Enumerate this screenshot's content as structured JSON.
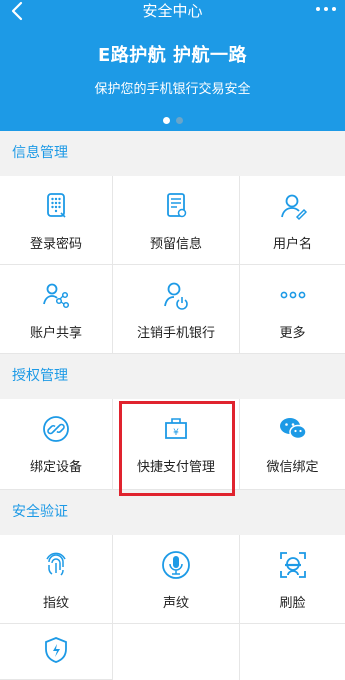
{
  "header": {
    "title": "安全中心"
  },
  "banner": {
    "title": "E路护航 护航一路",
    "subtitle": "保护您的手机银行交易安全"
  },
  "sections": {
    "info": {
      "title": "信息管理",
      "items": [
        "登录密码",
        "预留信息",
        "用户名",
        "账户共享",
        "注销手机银行",
        "更多"
      ]
    },
    "auth": {
      "title": "授权管理",
      "items": [
        "绑定设备",
        "快捷支付管理",
        "微信绑定"
      ]
    },
    "verify": {
      "title": "安全验证",
      "items": [
        "指纹",
        "声纹",
        "刷脸"
      ]
    }
  },
  "colors": {
    "primary": "#1d9ae6",
    "highlight": "#e0232e"
  },
  "icons": [
    "back-arrow-icon",
    "more-dots-icon",
    "keypad-icon",
    "document-icon",
    "user-edit-icon",
    "share-users-icon",
    "user-power-icon",
    "ellipsis-icon",
    "link-icon",
    "yuan-bag-icon",
    "wechat-icon",
    "fingerprint-icon",
    "microphone-icon",
    "face-scan-icon",
    "shield-bolt-icon"
  ]
}
